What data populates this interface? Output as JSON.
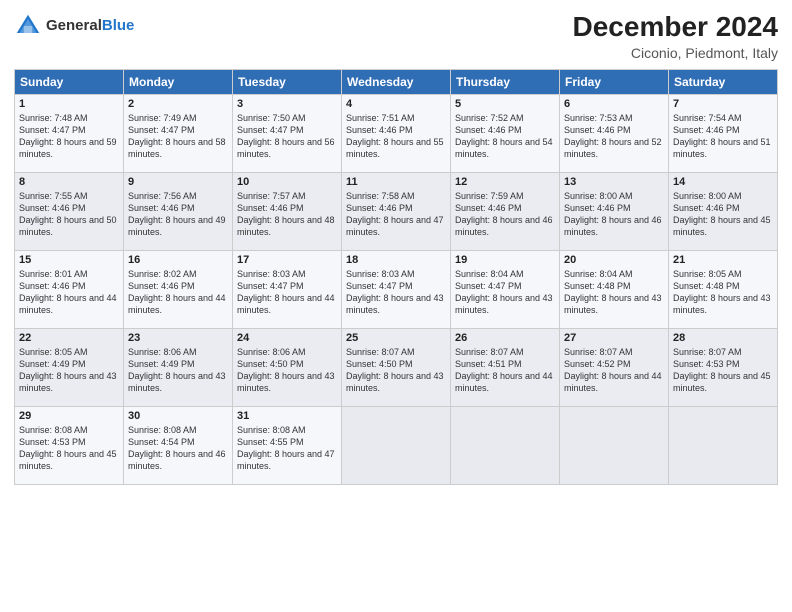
{
  "header": {
    "logo_general": "General",
    "logo_blue": "Blue",
    "month_title": "December 2024",
    "location": "Ciconio, Piedmont, Italy"
  },
  "columns": [
    "Sunday",
    "Monday",
    "Tuesday",
    "Wednesday",
    "Thursday",
    "Friday",
    "Saturday"
  ],
  "weeks": [
    [
      {
        "day": "1",
        "rise": "Sunrise: 7:48 AM",
        "set": "Sunset: 4:47 PM",
        "light": "Daylight: 8 hours and 59 minutes."
      },
      {
        "day": "2",
        "rise": "Sunrise: 7:49 AM",
        "set": "Sunset: 4:47 PM",
        "light": "Daylight: 8 hours and 58 minutes."
      },
      {
        "day": "3",
        "rise": "Sunrise: 7:50 AM",
        "set": "Sunset: 4:47 PM",
        "light": "Daylight: 8 hours and 56 minutes."
      },
      {
        "day": "4",
        "rise": "Sunrise: 7:51 AM",
        "set": "Sunset: 4:46 PM",
        "light": "Daylight: 8 hours and 55 minutes."
      },
      {
        "day": "5",
        "rise": "Sunrise: 7:52 AM",
        "set": "Sunset: 4:46 PM",
        "light": "Daylight: 8 hours and 54 minutes."
      },
      {
        "day": "6",
        "rise": "Sunrise: 7:53 AM",
        "set": "Sunset: 4:46 PM",
        "light": "Daylight: 8 hours and 52 minutes."
      },
      {
        "day": "7",
        "rise": "Sunrise: 7:54 AM",
        "set": "Sunset: 4:46 PM",
        "light": "Daylight: 8 hours and 51 minutes."
      }
    ],
    [
      {
        "day": "8",
        "rise": "Sunrise: 7:55 AM",
        "set": "Sunset: 4:46 PM",
        "light": "Daylight: 8 hours and 50 minutes."
      },
      {
        "day": "9",
        "rise": "Sunrise: 7:56 AM",
        "set": "Sunset: 4:46 PM",
        "light": "Daylight: 8 hours and 49 minutes."
      },
      {
        "day": "10",
        "rise": "Sunrise: 7:57 AM",
        "set": "Sunset: 4:46 PM",
        "light": "Daylight: 8 hours and 48 minutes."
      },
      {
        "day": "11",
        "rise": "Sunrise: 7:58 AM",
        "set": "Sunset: 4:46 PM",
        "light": "Daylight: 8 hours and 47 minutes."
      },
      {
        "day": "12",
        "rise": "Sunrise: 7:59 AM",
        "set": "Sunset: 4:46 PM",
        "light": "Daylight: 8 hours and 46 minutes."
      },
      {
        "day": "13",
        "rise": "Sunrise: 8:00 AM",
        "set": "Sunset: 4:46 PM",
        "light": "Daylight: 8 hours and 46 minutes."
      },
      {
        "day": "14",
        "rise": "Sunrise: 8:00 AM",
        "set": "Sunset: 4:46 PM",
        "light": "Daylight: 8 hours and 45 minutes."
      }
    ],
    [
      {
        "day": "15",
        "rise": "Sunrise: 8:01 AM",
        "set": "Sunset: 4:46 PM",
        "light": "Daylight: 8 hours and 44 minutes."
      },
      {
        "day": "16",
        "rise": "Sunrise: 8:02 AM",
        "set": "Sunset: 4:46 PM",
        "light": "Daylight: 8 hours and 44 minutes."
      },
      {
        "day": "17",
        "rise": "Sunrise: 8:03 AM",
        "set": "Sunset: 4:47 PM",
        "light": "Daylight: 8 hours and 44 minutes."
      },
      {
        "day": "18",
        "rise": "Sunrise: 8:03 AM",
        "set": "Sunset: 4:47 PM",
        "light": "Daylight: 8 hours and 43 minutes."
      },
      {
        "day": "19",
        "rise": "Sunrise: 8:04 AM",
        "set": "Sunset: 4:47 PM",
        "light": "Daylight: 8 hours and 43 minutes."
      },
      {
        "day": "20",
        "rise": "Sunrise: 8:04 AM",
        "set": "Sunset: 4:48 PM",
        "light": "Daylight: 8 hours and 43 minutes."
      },
      {
        "day": "21",
        "rise": "Sunrise: 8:05 AM",
        "set": "Sunset: 4:48 PM",
        "light": "Daylight: 8 hours and 43 minutes."
      }
    ],
    [
      {
        "day": "22",
        "rise": "Sunrise: 8:05 AM",
        "set": "Sunset: 4:49 PM",
        "light": "Daylight: 8 hours and 43 minutes."
      },
      {
        "day": "23",
        "rise": "Sunrise: 8:06 AM",
        "set": "Sunset: 4:49 PM",
        "light": "Daylight: 8 hours and 43 minutes."
      },
      {
        "day": "24",
        "rise": "Sunrise: 8:06 AM",
        "set": "Sunset: 4:50 PM",
        "light": "Daylight: 8 hours and 43 minutes."
      },
      {
        "day": "25",
        "rise": "Sunrise: 8:07 AM",
        "set": "Sunset: 4:50 PM",
        "light": "Daylight: 8 hours and 43 minutes."
      },
      {
        "day": "26",
        "rise": "Sunrise: 8:07 AM",
        "set": "Sunset: 4:51 PM",
        "light": "Daylight: 8 hours and 44 minutes."
      },
      {
        "day": "27",
        "rise": "Sunrise: 8:07 AM",
        "set": "Sunset: 4:52 PM",
        "light": "Daylight: 8 hours and 44 minutes."
      },
      {
        "day": "28",
        "rise": "Sunrise: 8:07 AM",
        "set": "Sunset: 4:53 PM",
        "light": "Daylight: 8 hours and 45 minutes."
      }
    ],
    [
      {
        "day": "29",
        "rise": "Sunrise: 8:08 AM",
        "set": "Sunset: 4:53 PM",
        "light": "Daylight: 8 hours and 45 minutes."
      },
      {
        "day": "30",
        "rise": "Sunrise: 8:08 AM",
        "set": "Sunset: 4:54 PM",
        "light": "Daylight: 8 hours and 46 minutes."
      },
      {
        "day": "31",
        "rise": "Sunrise: 8:08 AM",
        "set": "Sunset: 4:55 PM",
        "light": "Daylight: 8 hours and 47 minutes."
      },
      null,
      null,
      null,
      null
    ]
  ]
}
